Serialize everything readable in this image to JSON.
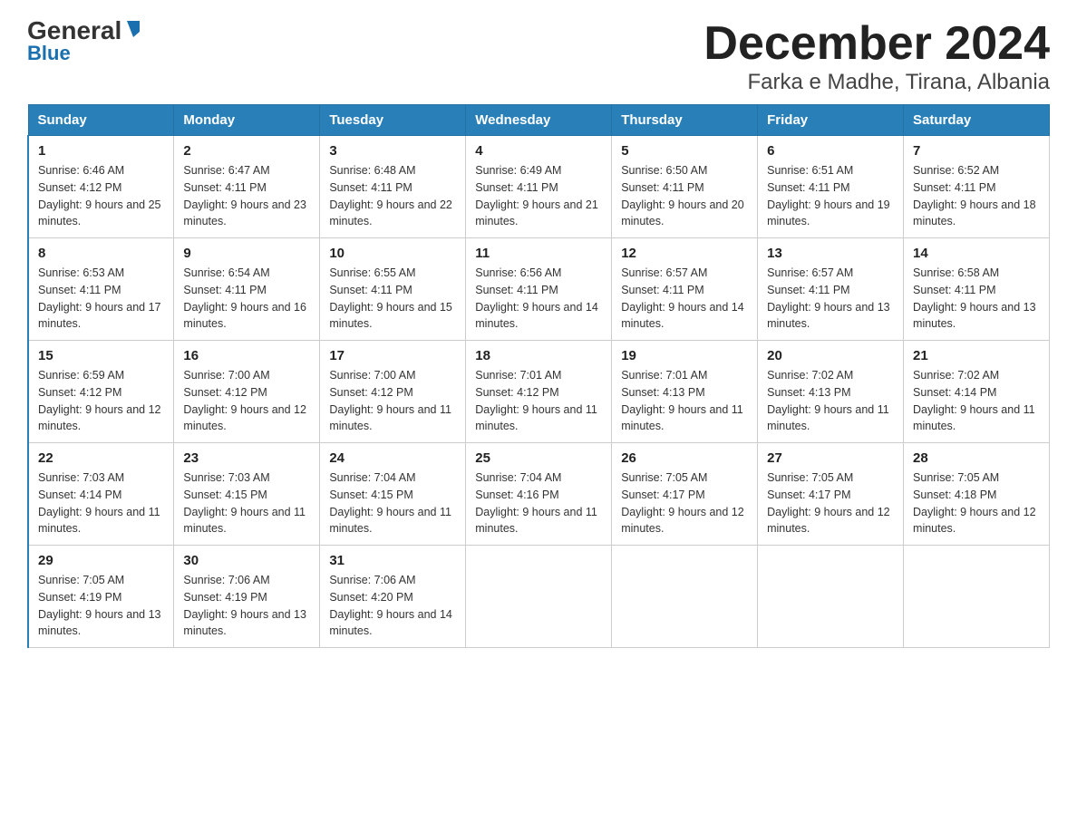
{
  "header": {
    "logo_general": "General",
    "logo_blue": "Blue",
    "title": "December 2024",
    "subtitle": "Farka e Madhe, Tirana, Albania"
  },
  "days_of_week": [
    "Sunday",
    "Monday",
    "Tuesday",
    "Wednesday",
    "Thursday",
    "Friday",
    "Saturday"
  ],
  "weeks": [
    [
      {
        "day": "1",
        "sunrise": "6:46 AM",
        "sunset": "4:12 PM",
        "daylight": "9 hours and 25 minutes."
      },
      {
        "day": "2",
        "sunrise": "6:47 AM",
        "sunset": "4:11 PM",
        "daylight": "9 hours and 23 minutes."
      },
      {
        "day": "3",
        "sunrise": "6:48 AM",
        "sunset": "4:11 PM",
        "daylight": "9 hours and 22 minutes."
      },
      {
        "day": "4",
        "sunrise": "6:49 AM",
        "sunset": "4:11 PM",
        "daylight": "9 hours and 21 minutes."
      },
      {
        "day": "5",
        "sunrise": "6:50 AM",
        "sunset": "4:11 PM",
        "daylight": "9 hours and 20 minutes."
      },
      {
        "day": "6",
        "sunrise": "6:51 AM",
        "sunset": "4:11 PM",
        "daylight": "9 hours and 19 minutes."
      },
      {
        "day": "7",
        "sunrise": "6:52 AM",
        "sunset": "4:11 PM",
        "daylight": "9 hours and 18 minutes."
      }
    ],
    [
      {
        "day": "8",
        "sunrise": "6:53 AM",
        "sunset": "4:11 PM",
        "daylight": "9 hours and 17 minutes."
      },
      {
        "day": "9",
        "sunrise": "6:54 AM",
        "sunset": "4:11 PM",
        "daylight": "9 hours and 16 minutes."
      },
      {
        "day": "10",
        "sunrise": "6:55 AM",
        "sunset": "4:11 PM",
        "daylight": "9 hours and 15 minutes."
      },
      {
        "day": "11",
        "sunrise": "6:56 AM",
        "sunset": "4:11 PM",
        "daylight": "9 hours and 14 minutes."
      },
      {
        "day": "12",
        "sunrise": "6:57 AM",
        "sunset": "4:11 PM",
        "daylight": "9 hours and 14 minutes."
      },
      {
        "day": "13",
        "sunrise": "6:57 AM",
        "sunset": "4:11 PM",
        "daylight": "9 hours and 13 minutes."
      },
      {
        "day": "14",
        "sunrise": "6:58 AM",
        "sunset": "4:11 PM",
        "daylight": "9 hours and 13 minutes."
      }
    ],
    [
      {
        "day": "15",
        "sunrise": "6:59 AM",
        "sunset": "4:12 PM",
        "daylight": "9 hours and 12 minutes."
      },
      {
        "day": "16",
        "sunrise": "7:00 AM",
        "sunset": "4:12 PM",
        "daylight": "9 hours and 12 minutes."
      },
      {
        "day": "17",
        "sunrise": "7:00 AM",
        "sunset": "4:12 PM",
        "daylight": "9 hours and 11 minutes."
      },
      {
        "day": "18",
        "sunrise": "7:01 AM",
        "sunset": "4:12 PM",
        "daylight": "9 hours and 11 minutes."
      },
      {
        "day": "19",
        "sunrise": "7:01 AM",
        "sunset": "4:13 PM",
        "daylight": "9 hours and 11 minutes."
      },
      {
        "day": "20",
        "sunrise": "7:02 AM",
        "sunset": "4:13 PM",
        "daylight": "9 hours and 11 minutes."
      },
      {
        "day": "21",
        "sunrise": "7:02 AM",
        "sunset": "4:14 PM",
        "daylight": "9 hours and 11 minutes."
      }
    ],
    [
      {
        "day": "22",
        "sunrise": "7:03 AM",
        "sunset": "4:14 PM",
        "daylight": "9 hours and 11 minutes."
      },
      {
        "day": "23",
        "sunrise": "7:03 AM",
        "sunset": "4:15 PM",
        "daylight": "9 hours and 11 minutes."
      },
      {
        "day": "24",
        "sunrise": "7:04 AM",
        "sunset": "4:15 PM",
        "daylight": "9 hours and 11 minutes."
      },
      {
        "day": "25",
        "sunrise": "7:04 AM",
        "sunset": "4:16 PM",
        "daylight": "9 hours and 11 minutes."
      },
      {
        "day": "26",
        "sunrise": "7:05 AM",
        "sunset": "4:17 PM",
        "daylight": "9 hours and 12 minutes."
      },
      {
        "day": "27",
        "sunrise": "7:05 AM",
        "sunset": "4:17 PM",
        "daylight": "9 hours and 12 minutes."
      },
      {
        "day": "28",
        "sunrise": "7:05 AM",
        "sunset": "4:18 PM",
        "daylight": "9 hours and 12 minutes."
      }
    ],
    [
      {
        "day": "29",
        "sunrise": "7:05 AM",
        "sunset": "4:19 PM",
        "daylight": "9 hours and 13 minutes."
      },
      {
        "day": "30",
        "sunrise": "7:06 AM",
        "sunset": "4:19 PM",
        "daylight": "9 hours and 13 minutes."
      },
      {
        "day": "31",
        "sunrise": "7:06 AM",
        "sunset": "4:20 PM",
        "daylight": "9 hours and 14 minutes."
      },
      null,
      null,
      null,
      null
    ]
  ]
}
